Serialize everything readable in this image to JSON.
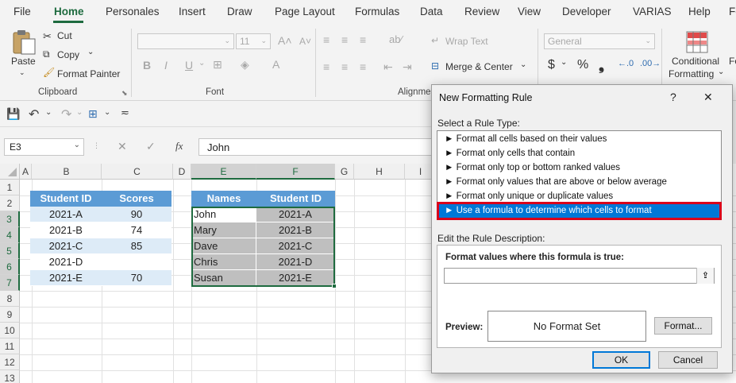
{
  "menu": {
    "tabs": [
      "File",
      "Home",
      "Personales",
      "Insert",
      "Draw",
      "Page Layout",
      "Formulas",
      "Data",
      "Review",
      "View",
      "Developer",
      "VARIAS",
      "Help",
      "Fo"
    ]
  },
  "ribbon": {
    "paste": "Paste",
    "cut": "Cut",
    "copy": "Copy",
    "format_painter": "Format Painter",
    "clipboard": "Clipboard",
    "font_size": "11",
    "bold": "B",
    "italic": "I",
    "underline": "U",
    "font_group": "Font",
    "wrap_text": "Wrap Text",
    "merge_center": "Merge & Center",
    "alignment_group": "Alignme",
    "number_format": "General",
    "currency": "$",
    "percent": "%",
    "comma": "❟",
    "conditional_formatting_1": "Conditional",
    "conditional_formatting_2": "Formatting",
    "fo_cut": "Fo"
  },
  "formula_bar": {
    "name_box": "E3",
    "fx": "fx",
    "value": "John"
  },
  "grid": {
    "columns": [
      "A",
      "B",
      "C",
      "D",
      "E",
      "F",
      "G",
      "H",
      "I"
    ],
    "rows": [
      "1",
      "2",
      "3",
      "4",
      "5",
      "6",
      "7",
      "8",
      "9",
      "10",
      "11",
      "12",
      "13"
    ],
    "table1": {
      "headers": [
        "Student ID",
        "Scores"
      ],
      "rows": [
        {
          "id": "2021-A",
          "score": "90"
        },
        {
          "id": "2021-B",
          "score": "74"
        },
        {
          "id": "2021-C",
          "score": "85"
        },
        {
          "id": "2021-D",
          "score": ""
        },
        {
          "id": "2021-E",
          "score": "70"
        }
      ]
    },
    "table2": {
      "headers": [
        "Names",
        "Student ID"
      ],
      "rows": [
        {
          "name": "John",
          "id": "2021-A"
        },
        {
          "name": "Mary",
          "id": "2021-B"
        },
        {
          "name": "Dave",
          "id": "2021-C"
        },
        {
          "name": "Chris",
          "id": "2021-D"
        },
        {
          "name": "Susan",
          "id": "2021-E"
        }
      ]
    }
  },
  "dialog": {
    "title": "New Formatting Rule",
    "help": "?",
    "close": "✕",
    "select_rule_type": "Select a Rule Type:",
    "rule_types": [
      "Format all cells based on their values",
      "Format only cells that contain",
      "Format only top or bottom ranked values",
      "Format only values that are above or below average",
      "Format only unique or duplicate values",
      "Use a formula to determine which cells to format"
    ],
    "selected_rule_index": 5,
    "edit_description": "Edit the Rule Description:",
    "formula_label": "Format values where this formula is true:",
    "formula_value": "",
    "preview_label": "Preview:",
    "preview_text": "No Format Set",
    "format_button": "Format...",
    "ok_button": "OK",
    "cancel_button": "Cancel"
  },
  "colors": {
    "excel_green": "#1e6b3f",
    "table_header": "#5b9bd5",
    "table_band": "#ddebf7",
    "selection_blue": "#0078d7",
    "highlight_red": "#d9001b",
    "gray_fill": "#bfbfbf"
  }
}
